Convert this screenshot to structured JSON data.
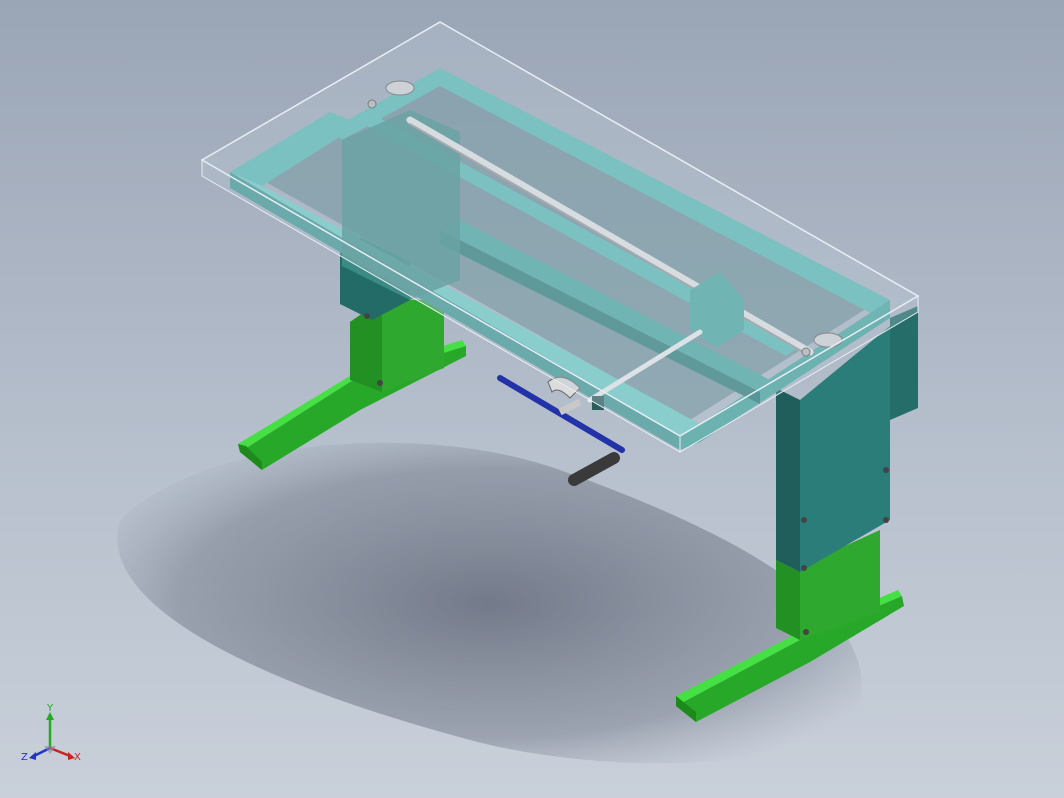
{
  "viewport": {
    "background_top": "#9aa5b6",
    "background_bottom": "#c9d0da"
  },
  "model": {
    "frame_color": "#5bbdb7",
    "top_glass_color": "#b9c8d4",
    "leg_color": "#2f7f7a",
    "foot_color": "#33cc33",
    "handle_color": "#2233aa",
    "shaft_color": "#e6e6e6"
  },
  "triad": {
    "x_label": "X",
    "y_label": "Y",
    "z_label": "Z",
    "x_color": "#cc2222",
    "y_color": "#22aa22",
    "z_color": "#2233cc"
  }
}
